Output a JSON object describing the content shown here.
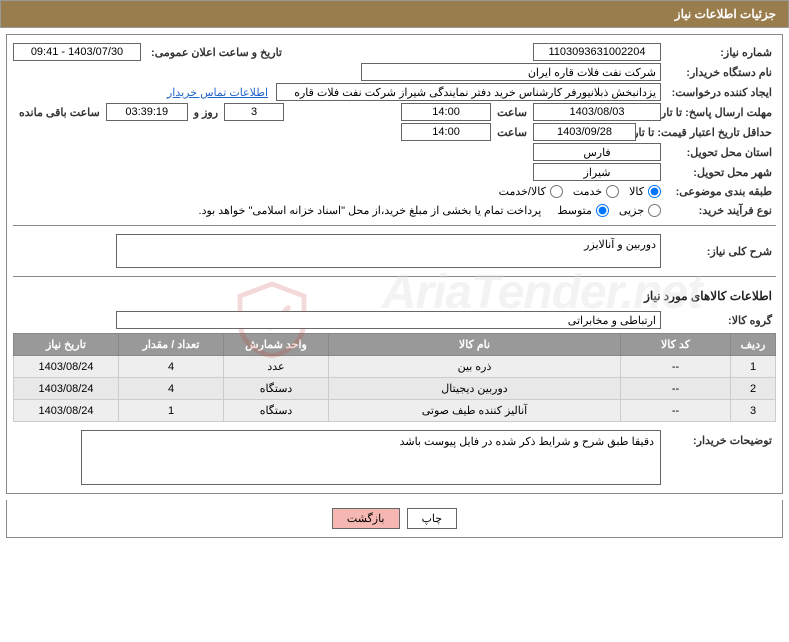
{
  "header": "جزئیات اطلاعات نیاز",
  "labels": {
    "need_no": "شماره نیاز:",
    "announce": "تاریخ و ساعت اعلان عمومی:",
    "buyer_org": "نام دستگاه خریدار:",
    "requester": "ایجاد کننده درخواست:",
    "contact": "اطلاعات تماس خریدار",
    "deadline": "مهلت ارسال پاسخ: تا تاریخ:",
    "time": "ساعت",
    "days_and": "روز و",
    "remaining": "ساعت باقی مانده",
    "validity": "حداقل تاریخ اعتبار قیمت: تا تاریخ:",
    "province": "استان محل تحویل:",
    "city": "شهر محل تحویل:",
    "category": "طبقه بندی موضوعی:",
    "proc_type": "نوع فرآیند خرید:",
    "overview": "شرح کلی نیاز:",
    "section_items": "اطلاعات کالاهای مورد نیاز",
    "goods_group": "گروه کالا:",
    "buyer_notes": "توضیحات خریدار:"
  },
  "values": {
    "need_no": "1103093631002204",
    "announce": "1403/07/30 - 09:41",
    "buyer_org": "شرکت نفت فلات قاره ایران",
    "requester": "یزدانبخش ذبلانیورفر کارشناس خرید دفتر نمایندگی شیراز شرکت نفت فلات قاره",
    "deadline_date": "1403/08/03",
    "deadline_time": "14:00",
    "days": "3",
    "remaining_time": "03:39:19",
    "validity_date": "1403/09/28",
    "validity_time": "14:00",
    "province": "فارس",
    "city": "شیراز",
    "proc_note": "پرداخت تمام یا بخشی از مبلغ خرید،از محل \"اسناد خزانه اسلامی\" خواهد بود.",
    "overview": "دوربین و آنالایزر",
    "goods_group": "ارتباطی و مخابراتی",
    "buyer_notes": "دقیقا طبق شرح و شرایط ذکر شده در فایل پیوست باشد"
  },
  "radios": {
    "cat": {
      "goods": "کالا",
      "service": "خدمت",
      "both": "کالا/خدمت"
    },
    "proc": {
      "small": "جزیی",
      "medium": "متوسط"
    }
  },
  "table": {
    "headers": {
      "row": "ردیف",
      "code": "کد کالا",
      "name": "نام کالا",
      "unit": "واحد شمارش",
      "qty": "تعداد / مقدار",
      "date": "تاریخ نیاز"
    },
    "rows": [
      {
        "row": "1",
        "code": "--",
        "name": "ذره بین",
        "unit": "عدد",
        "qty": "4",
        "date": "1403/08/24"
      },
      {
        "row": "2",
        "code": "--",
        "name": "دوربین دیجیتال",
        "unit": "دستگاه",
        "qty": "4",
        "date": "1403/08/24"
      },
      {
        "row": "3",
        "code": "--",
        "name": "آنالیز کننده طیف صوتی",
        "unit": "دستگاه",
        "qty": "1",
        "date": "1403/08/24"
      }
    ]
  },
  "buttons": {
    "print": "چاپ",
    "back": "بازگشت"
  },
  "watermark": "AriaTender.net"
}
